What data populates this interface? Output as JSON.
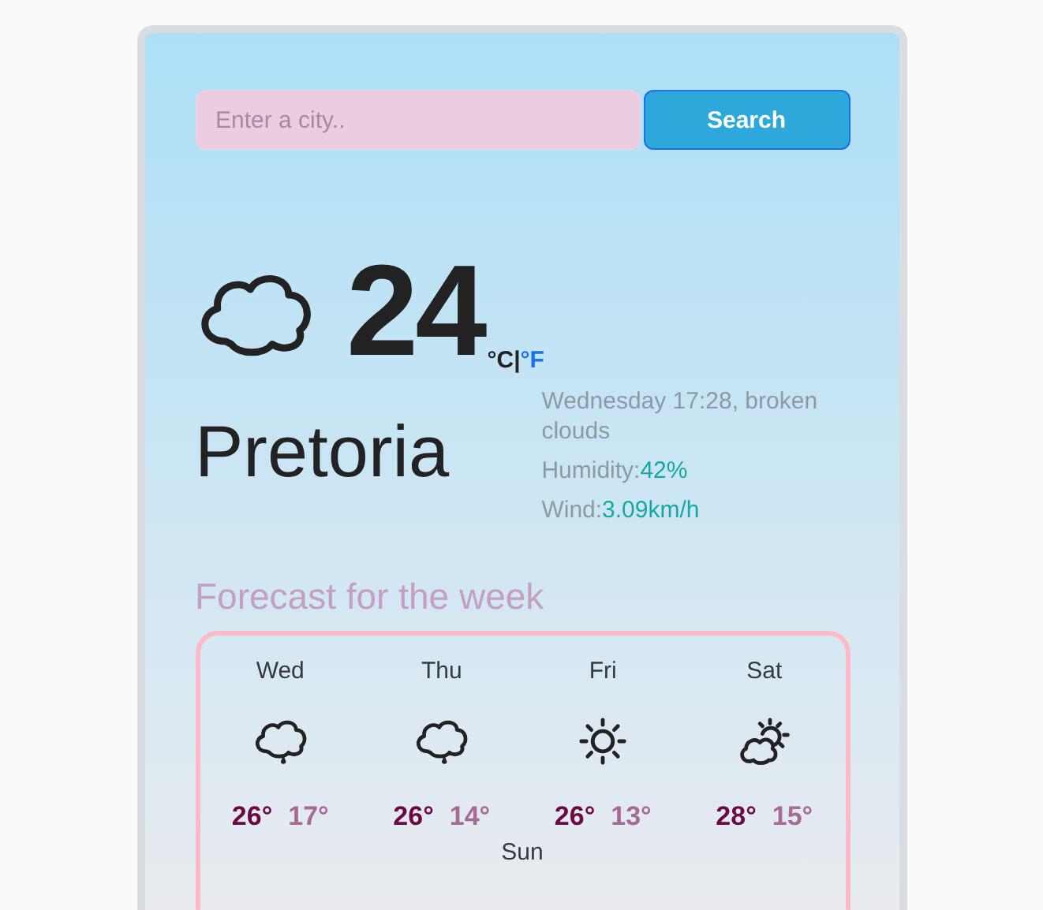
{
  "search": {
    "placeholder": "Enter a city..",
    "button": "Search"
  },
  "current": {
    "kind": "cloud",
    "temperature": "24",
    "units": [
      {
        "label": "°C",
        "selected": true
      },
      {
        "label": "|",
        "selected": true
      },
      {
        "label": "°F",
        "selected": false
      }
    ],
    "city": "Pretoria",
    "description": "Wednesday 17:28, broken clouds",
    "humidity_label": "Humidity:",
    "humidity": "42%",
    "wind_label": "Wind:",
    "wind": "3.09km/h"
  },
  "forecast": {
    "title": "Forecast for the week",
    "days": [
      {
        "day": "Wed",
        "kind": "rain",
        "max": "26°",
        "min": "17°"
      },
      {
        "day": "Thu",
        "kind": "rain",
        "max": "26°",
        "min": "14°"
      },
      {
        "day": "Fri",
        "kind": "sun",
        "max": "26°",
        "min": "13°"
      },
      {
        "day": "Sat",
        "kind": "partly-cloudy",
        "max": "28°",
        "min": "15°"
      },
      {
        "day": "Sun"
      }
    ]
  }
}
